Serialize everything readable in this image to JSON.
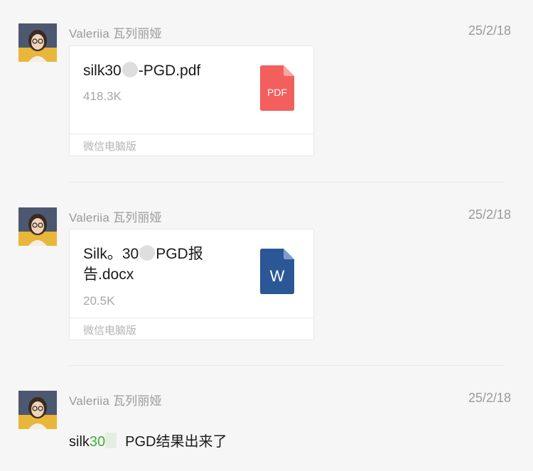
{
  "messages": [
    {
      "sender": "Valeriia 瓦列丽娅",
      "time": "25/2/18",
      "type": "file",
      "file": {
        "name_pre": "silk30",
        "name_post": "-PGD.pdf",
        "size": "418.3K",
        "source": "微信电脑版",
        "icon": "pdf-icon",
        "icon_label": "PDF",
        "icon_color": "#f25f5c"
      }
    },
    {
      "sender": "Valeriia 瓦列丽娅",
      "time": "25/2/18",
      "type": "file",
      "file": {
        "name_pre": "Silk。30",
        "name_post": "PGD报告.docx",
        "size": "20.5K",
        "source": "微信电脑版",
        "icon": "word-icon",
        "icon_label": "W",
        "icon_color": "#2b5797"
      }
    },
    {
      "sender": "Valeriia 瓦列丽娅",
      "time": "25/2/18",
      "type": "text",
      "text_pre": "silk",
      "text_green": "30",
      "text_post": "PGD结果出来了"
    }
  ],
  "colors": {
    "background": "#f6f6f6",
    "meta_text": "#9a9a9a",
    "link_green": "#3cb035"
  }
}
